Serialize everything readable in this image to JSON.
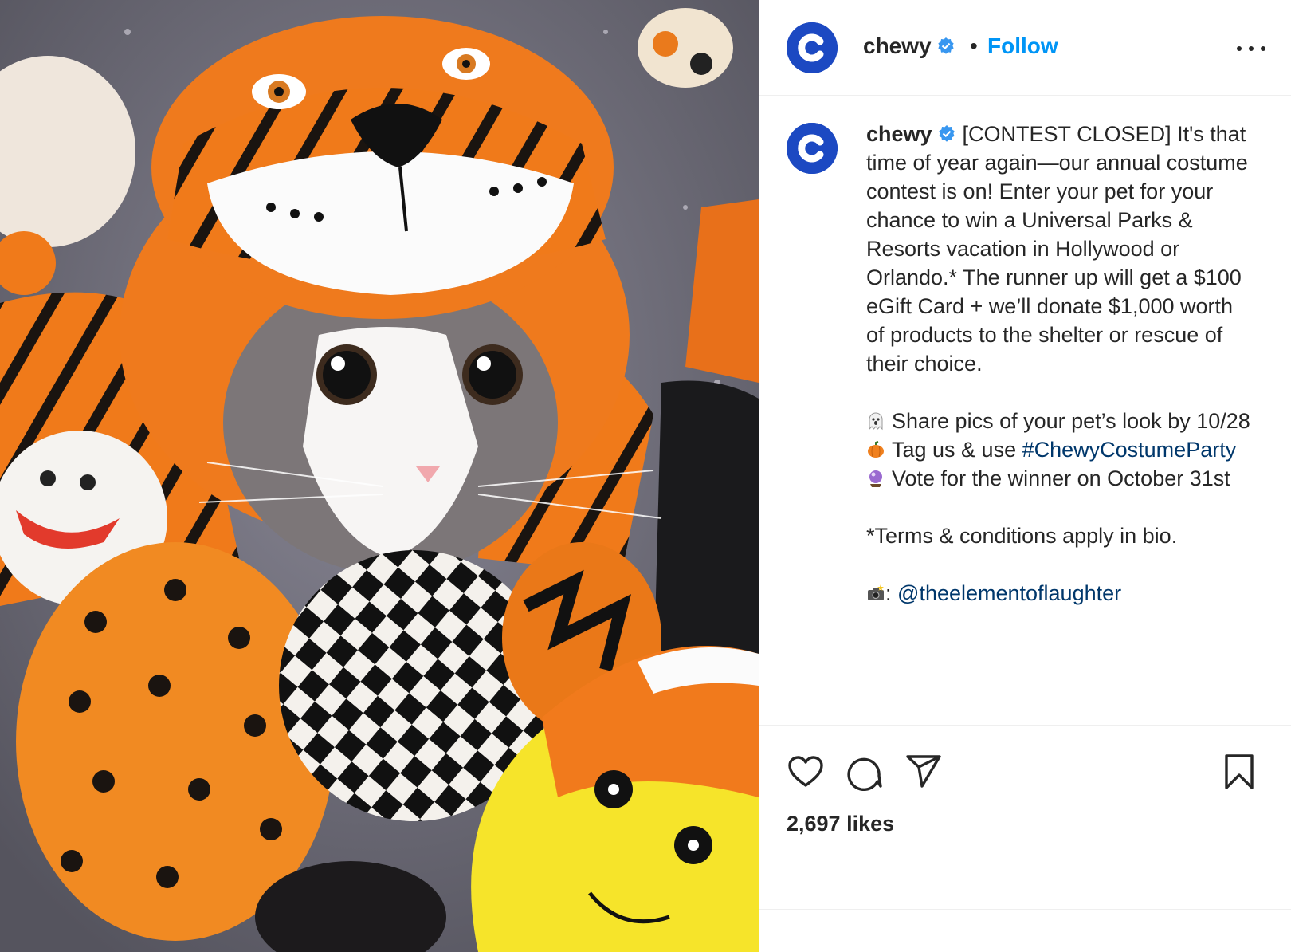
{
  "post": {
    "username": "chewy",
    "avatar_letter": "c",
    "separator": "•",
    "follow_label": "Follow",
    "more_icon": "more-options-icon"
  },
  "caption": {
    "username": "chewy",
    "line1": "[CONTEST CLOSED] It's that time of year again—our annual costume contest is on! Enter your pet for your chance to win a Universal Parks & Resorts vacation in Hollywood or Orlando.* The runner up will get a $100 eGift Card + we’ll donate $1,000 worth of products to the shelter or rescue of their choice.",
    "bullet1": "Share pics of your pet’s look by 10/28",
    "bullet2_text": "Tag us & use",
    "hashtag": "#ChewyCostumeParty",
    "bullet3": "Vote for the winner on October 31st",
    "terms": "*Terms & conditions apply in bio.",
    "credit_sep": ":",
    "credit_handle": "@theelementoflaughter"
  },
  "icons": {
    "bullet1": "ghost-emoji-icon",
    "bullet2": "pumpkin-emoji-icon",
    "bullet3": "crystal-ball-emoji-icon",
    "credit": "camera-flash-emoji-icon"
  },
  "actions": {
    "like_icon": "heart-icon",
    "comment_icon": "comment-icon",
    "share_icon": "share-icon",
    "save_icon": "bookmark-icon",
    "likes_text": "2,697 likes"
  },
  "colors": {
    "brand_blue": "#1c49c2",
    "follow_blue": "#0095f6",
    "link_blue": "#00376b",
    "verified_blue": "#3897f0"
  }
}
